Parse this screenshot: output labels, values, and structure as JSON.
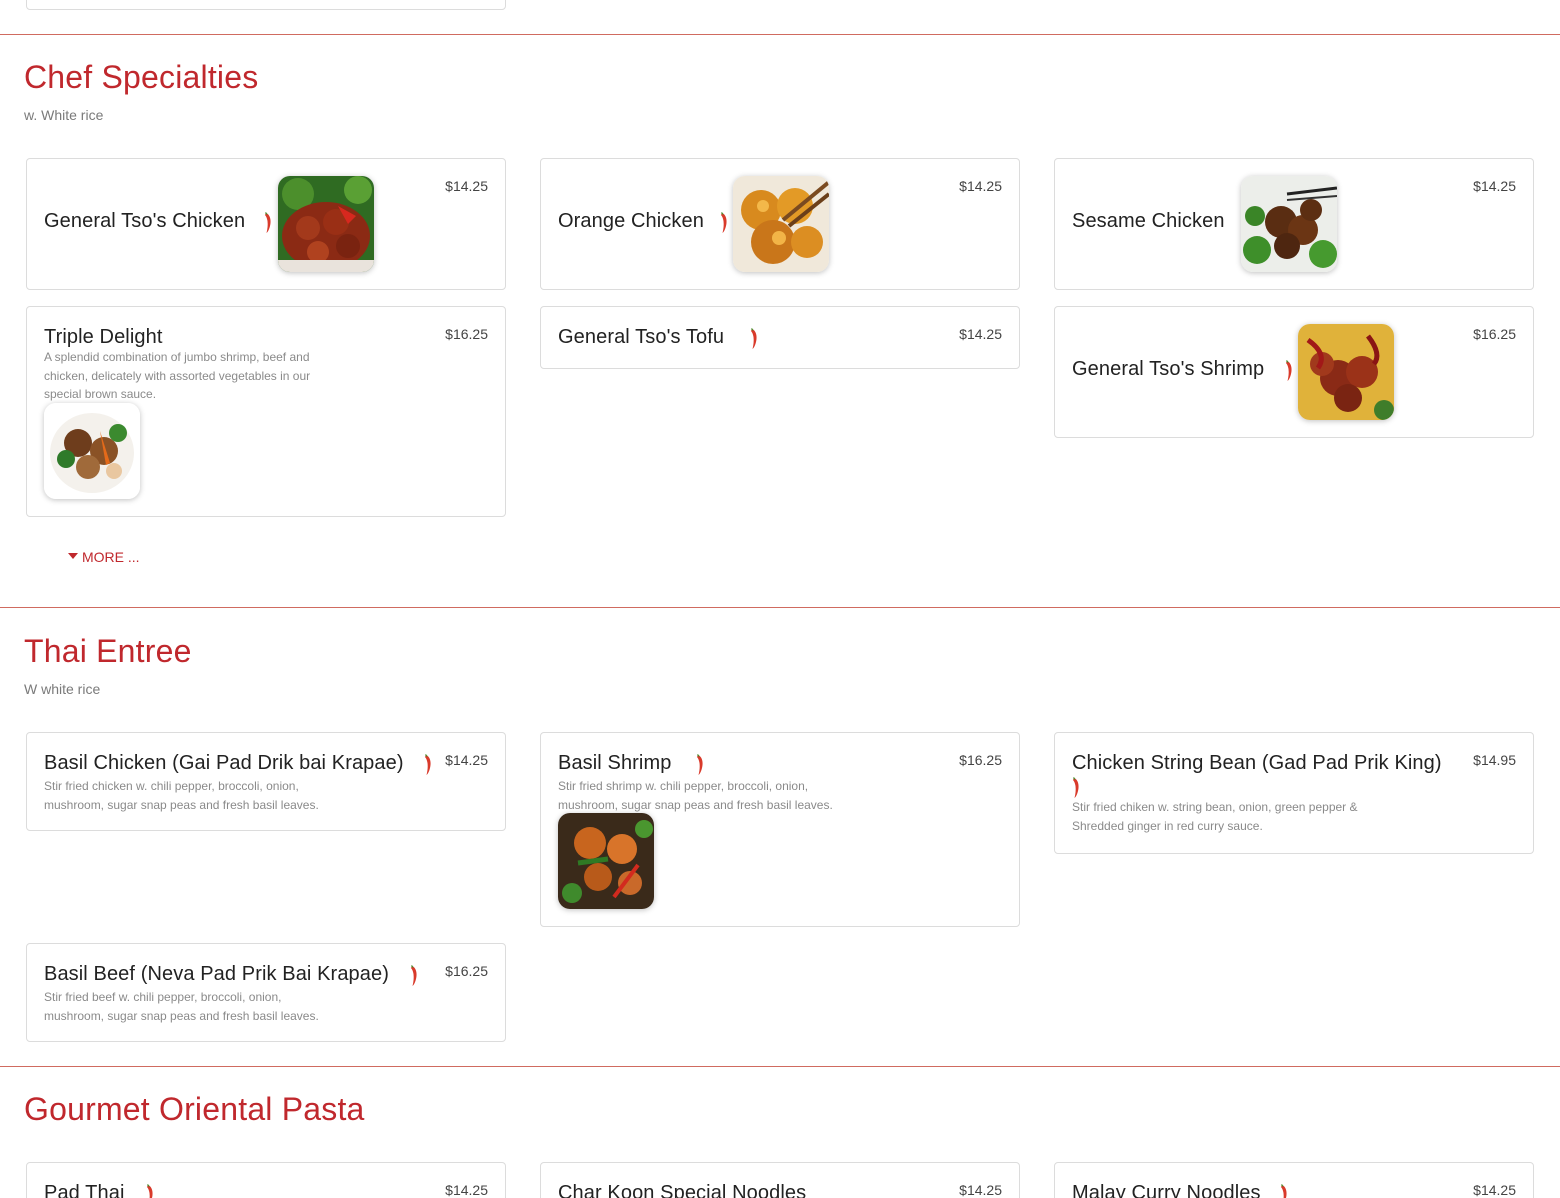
{
  "sections": {
    "chef": {
      "title": "Chef Specialties",
      "subtitle": "w. White rice",
      "more_label": "MORE ...",
      "items": [
        {
          "name": "General Tso's Chicken",
          "price": "$14.25",
          "spicy": true
        },
        {
          "name": "Orange Chicken",
          "price": "$14.25",
          "spicy": true
        },
        {
          "name": "Sesame Chicken",
          "price": "$14.25",
          "spicy": false
        },
        {
          "name": "Triple Delight",
          "price": "$16.25",
          "spicy": false,
          "description": "A splendid combination of jumbo shrimp, beef and\nchicken, delicately with assorted vegetables in our\nspecial brown sauce."
        },
        {
          "name": "General Tso's Tofu",
          "price": "$14.25",
          "spicy": true
        },
        {
          "name": "General Tso's Shrimp",
          "price": "$16.25",
          "spicy": true
        }
      ]
    },
    "thai": {
      "title": "Thai Entree",
      "subtitle": "W white rice",
      "items": [
        {
          "name": "Basil Chicken (Gai Pad Drik bai Krapae)",
          "price": "$14.25",
          "spicy": true,
          "description": "Stir fried chicken w. chili pepper, broccoli, onion,\nmushroom, sugar snap peas and fresh basil leaves."
        },
        {
          "name": "Basil Shrimp",
          "price": "$16.25",
          "spicy": true,
          "description": "Stir fried shrimp w. chili pepper, broccoli, onion,\nmushroom, sugar snap peas and fresh basil leaves."
        },
        {
          "name": "Chicken String Bean (Gad Pad Prik King)",
          "price": "$14.95",
          "spicy": true,
          "description": "Stir fried chiken w. string bean, onion, green pepper &\nShredded ginger in red curry sauce."
        },
        {
          "name": "Basil Beef (Neva Pad Prik Bai Krapae)",
          "price": "$16.25",
          "spicy": true,
          "description": "Stir fried beef w. chili pepper, broccoli, onion,\nmushroom, sugar snap peas and fresh basil leaves."
        }
      ]
    },
    "pasta": {
      "title": "Gourmet Oriental Pasta",
      "items": [
        {
          "name": "Pad Thai",
          "price": "$14.25",
          "spicy": true
        },
        {
          "name": "Char Koon Special Noodles",
          "price": "$14.25",
          "spicy": false
        },
        {
          "name": "Malay Curry Noodles",
          "price": "$14.25",
          "spicy": true
        }
      ]
    }
  },
  "icons": {
    "spicy": "chili-pepper-icon",
    "more": "caret-down-icon"
  },
  "colors": {
    "accent": "#c0282d",
    "chili": "#d93a2b",
    "border": "#dcdcdc",
    "muted_text": "#8a8a8a"
  }
}
